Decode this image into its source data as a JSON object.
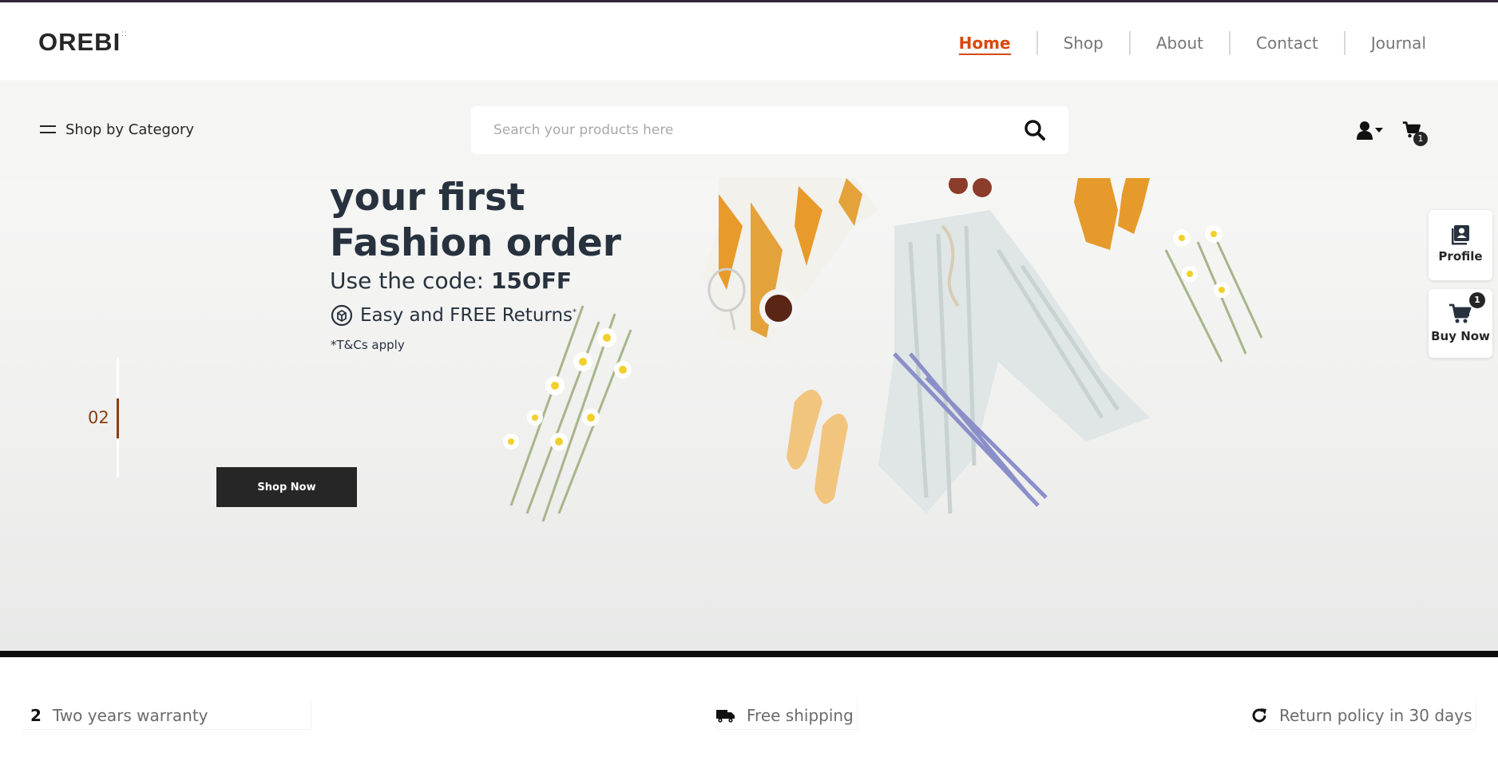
{
  "header": {
    "logo": "OREBI",
    "logo_mark": "::",
    "nav": [
      {
        "label": "Home",
        "active": true
      },
      {
        "label": "Shop",
        "active": false
      },
      {
        "label": "About",
        "active": false
      },
      {
        "label": "Contact",
        "active": false
      },
      {
        "label": "Journal",
        "active": false
      }
    ],
    "accent_color": "#d9480f"
  },
  "toolbar": {
    "category_label": "Shop by Category",
    "search_placeholder": "Search your products here",
    "cart_count": "1"
  },
  "hero": {
    "title_line1": "your first",
    "title_line2": "Fashion order",
    "code_prefix": "Use the code:",
    "code": "15OFF",
    "returns": "Easy and FREE Returns",
    "returns_mark": "*",
    "terms": "*T&Cs apply",
    "slide_number": "02",
    "cta": "Shop Now"
  },
  "side": {
    "profile_label": "Profile",
    "buy_label": "Buy Now",
    "buy_count": "1"
  },
  "features": {
    "warranty_num": "2",
    "warranty": "Two years warranty",
    "shipping": "Free shipping",
    "returns": "Return policy in 30 days"
  }
}
